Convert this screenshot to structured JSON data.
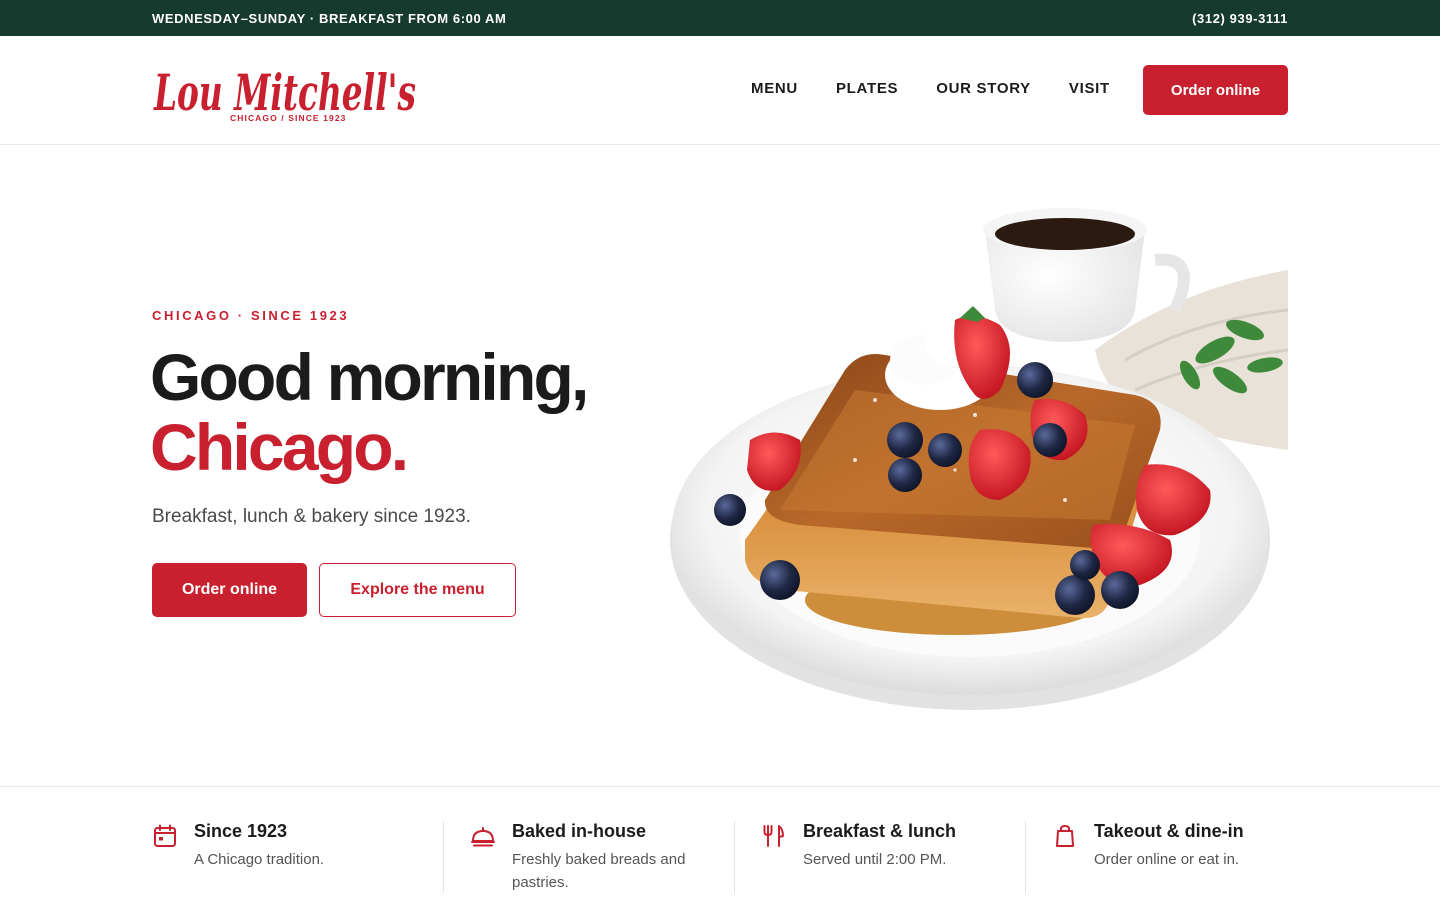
{
  "topbar": {
    "hours": "WEDNESDAY–SUNDAY · BREAKFAST FROM 6:00 AM",
    "phone": "(312) 939-3111"
  },
  "header": {
    "logo_script": "Lou Mitchell's",
    "logo_tagline": "CHICAGO / SINCE 1923",
    "nav": [
      {
        "label": "MENU"
      },
      {
        "label": "PLATES"
      },
      {
        "label": "OUR STORY"
      },
      {
        "label": "VISIT"
      }
    ],
    "cta_label": "Order online"
  },
  "hero": {
    "eyebrow": "CHICAGO · SINCE 1923",
    "title_line1": "Good morning,",
    "title_line2": "Chicago.",
    "subtitle": "Breakfast, lunch & bakery since 1923.",
    "primary_button": "Order online",
    "secondary_button": "Explore the menu",
    "image_subject": "french-toast-plate"
  },
  "features": [
    {
      "icon": "calendar-icon",
      "title": "Since 1923",
      "description": "A Chicago tradition."
    },
    {
      "icon": "bread-icon",
      "title": "Baked in-house",
      "description": "Freshly baked breads and pastries."
    },
    {
      "icon": "fork-knife-icon",
      "title": "Breakfast & lunch",
      "description": "Served until 2:00 PM."
    },
    {
      "icon": "takeout-bag-icon",
      "title": "Takeout & dine-in",
      "description": "Order online or eat in."
    }
  ],
  "colors": {
    "brand_red": "#c8202f",
    "topbar_green": "#173a2f",
    "text_dark": "#1b1b1b"
  }
}
